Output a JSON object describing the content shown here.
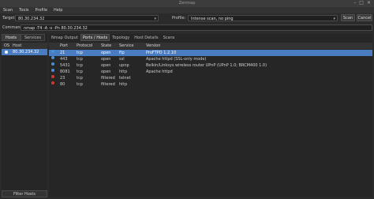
{
  "window": {
    "title": "Zenmap"
  },
  "menu": [
    "Scan",
    "Tools",
    "Profile",
    "Help"
  ],
  "target": {
    "label": "Target:",
    "value": "80.30.234.32"
  },
  "profile": {
    "label": "Profile:",
    "value": "Intense scan, no ping"
  },
  "buttons": {
    "scan": "Scan",
    "cancel": "Cancel"
  },
  "command": {
    "label": "Command:",
    "value": "nmap -T4 -A -v -Pn 80.30.234.32"
  },
  "left_tabs": [
    "Hosts",
    "Services"
  ],
  "host_columns": {
    "os": "OS",
    "host": "Host"
  },
  "hosts": [
    {
      "name": "80.30.234.32"
    }
  ],
  "filter_label": "Filter Hosts",
  "right_tabs": [
    "Nmap Output",
    "Ports / Hosts",
    "Topology",
    "Host Details",
    "Scans"
  ],
  "port_columns": {
    "port": "Port",
    "protocol": "Protocol",
    "state": "State",
    "service": "Service",
    "version": "Version"
  },
  "ports": [
    {
      "port": "21",
      "protocol": "tcp",
      "state": "open",
      "service": "ftp",
      "version": "ProFTPD 1.2.10",
      "status": "open"
    },
    {
      "port": "443",
      "protocol": "tcp",
      "state": "open",
      "service": "ssl",
      "version": "Apache httpd (SSL-only mode)",
      "status": "open"
    },
    {
      "port": "5431",
      "protocol": "tcp",
      "state": "open",
      "service": "upnp",
      "version": "Belkin/Linksys wireless router UPnP (UPnP 1.0; BRCM400 1.0)",
      "status": "open"
    },
    {
      "port": "8081",
      "protocol": "tcp",
      "state": "open",
      "service": "http",
      "version": "Apache httpd",
      "status": "open"
    },
    {
      "port": "23",
      "protocol": "tcp",
      "state": "filtered",
      "service": "telnet",
      "version": "",
      "status": "filtered"
    },
    {
      "port": "80",
      "protocol": "tcp",
      "state": "filtered",
      "service": "http",
      "version": "",
      "status": "filtered"
    }
  ],
  "colors": {
    "open": "#4a8fd6",
    "filtered": "#d03a2e",
    "selection": "#4a7cc2",
    "host_icon": "#ffffff"
  }
}
